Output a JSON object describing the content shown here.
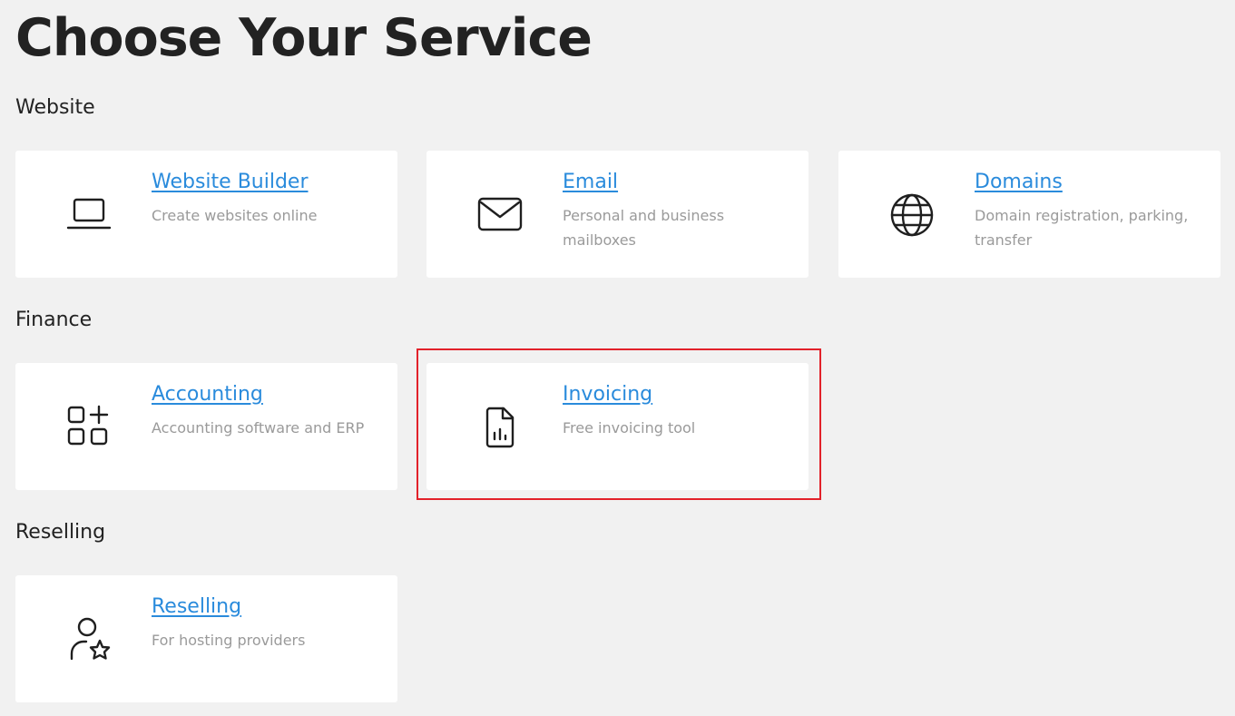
{
  "page": {
    "title": "Choose Your Service"
  },
  "sections": [
    {
      "label": "Website",
      "cards": [
        {
          "title": "Website Builder",
          "description": "Create websites online",
          "icon": "laptop-icon"
        },
        {
          "title": "Email",
          "description": "Personal and business mailboxes",
          "icon": "envelope-icon"
        },
        {
          "title": "Domains",
          "description": "Domain registration, parking, transfer",
          "icon": "globe-icon"
        }
      ]
    },
    {
      "label": "Finance",
      "cards": [
        {
          "title": "Accounting",
          "description": "Accounting software and ERP",
          "icon": "apps-add-icon"
        },
        {
          "title": "Invoicing",
          "description": "Free invoicing tool",
          "icon": "document-chart-icon"
        }
      ]
    },
    {
      "label": "Reselling",
      "cards": [
        {
          "title": "Reselling",
          "description": "For hosting providers",
          "icon": "user-star-icon"
        }
      ]
    }
  ],
  "colors": {
    "background": "#f1f1f1",
    "card": "#ffffff",
    "link": "#2a8bdc",
    "description": "#9a9a9a",
    "highlight": "#e2212a"
  }
}
